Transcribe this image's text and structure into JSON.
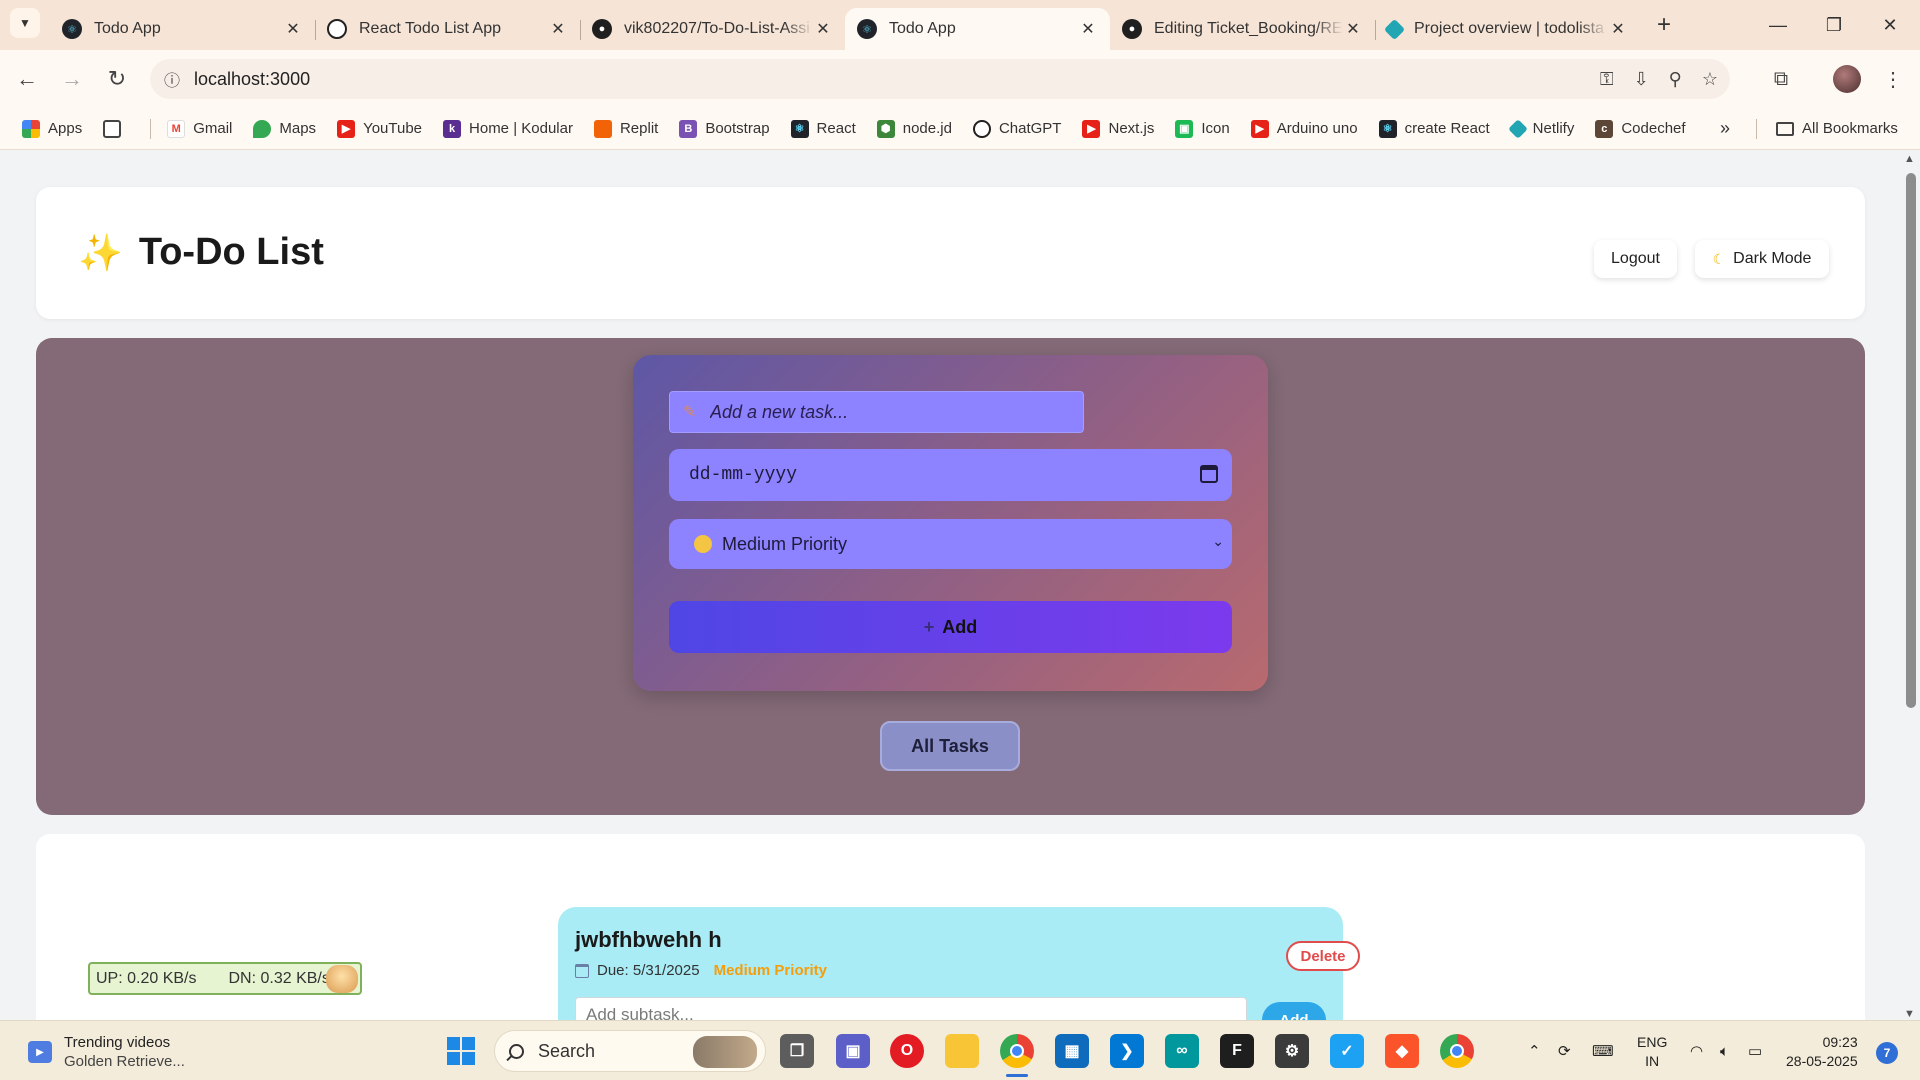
{
  "browser": {
    "tabs": [
      {
        "title": "Todo App",
        "favicon": "react-icon"
      },
      {
        "title": "React Todo List App",
        "favicon": "openai-icon"
      },
      {
        "title": "vik802207/To-Do-List-Assi",
        "favicon": "github-icon"
      },
      {
        "title": "Todo App",
        "favicon": "react-icon",
        "active": true
      },
      {
        "title": "Editing Ticket_Booking/RE",
        "favicon": "github-icon"
      },
      {
        "title": "Project overview | todolista",
        "favicon": "netlify-icon"
      }
    ],
    "url": "localhost:3000",
    "bookmarks": [
      "Apps",
      "Gmail",
      "Maps",
      "YouTube",
      "Home | Kodular",
      "Replit",
      "Bootstrap",
      "React",
      "node.jd",
      "ChatGPT",
      "Next.js",
      "Icon",
      "Arduino uno",
      "create React",
      "Netlify",
      "Codechef"
    ],
    "all_bookmarks": "All Bookmarks"
  },
  "app": {
    "title": "To-Do List",
    "logout_label": "Logout",
    "dark_mode_label": "Dark Mode",
    "task_placeholder": "Add a new task...",
    "date_placeholder": "dd-mm-yyyy",
    "priority_selected": "Medium Priority",
    "add_label": "Add",
    "filter_label": "All Tasks",
    "tasks": [
      {
        "title": "jwbfhbwehh h",
        "due": "Due: 5/31/2025",
        "priority": "Medium Priority",
        "delete_label": "Delete",
        "subtask_placeholder": "Add subtask...",
        "subtask_add_label": "Add"
      }
    ]
  },
  "widget": {
    "up": "UP: 0.20 KB/s",
    "down": "DN: 0.32 KB/s"
  },
  "taskbar": {
    "news_title": "Trending videos",
    "news_sub": "Golden Retrieve...",
    "search_label": "Search",
    "lang_top": "ENG",
    "lang_bottom": "IN",
    "time": "09:23",
    "date": "28-05-2025",
    "notifications": "7"
  },
  "colors": {
    "hero_bg": "#836a76",
    "input_bg": "#8d82ff",
    "add_button_from": "#4f46e5",
    "add_button_to": "#7c3aed",
    "task_card": "#a9ecf6",
    "priority_medium": "#f59e0b",
    "delete": "#e24b4b"
  }
}
